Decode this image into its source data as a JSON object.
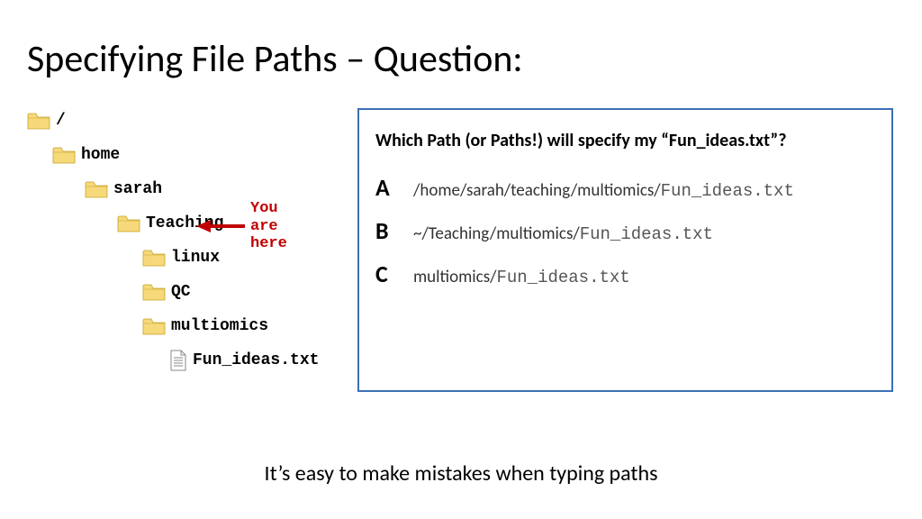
{
  "title": "Specifying File Paths – Question:",
  "tree": {
    "root": "/",
    "home": "home",
    "sarah": "sarah",
    "teaching": "Teaching",
    "linux": "linux",
    "qc": "QC",
    "multiomics": "multiomics",
    "file": "Fun_ideas.txt"
  },
  "annotation": {
    "line1": "You",
    "line2": "are",
    "line3": "here"
  },
  "question": {
    "prompt": "Which Path (or Paths!) will specify my “Fun_ideas.txt”?",
    "options": [
      {
        "letter": "A",
        "prefix": "/home/sarah/teaching/multiomics/",
        "mono": "Fun_ideas.txt"
      },
      {
        "letter": "B",
        "prefix": "~/Teaching/multiomics/",
        "mono": "Fun_ideas.txt"
      },
      {
        "letter": "C",
        "prefix": "multiomics/",
        "mono": "Fun_ideas.txt"
      }
    ]
  },
  "footer": "It’s easy to make mistakes when typing paths"
}
